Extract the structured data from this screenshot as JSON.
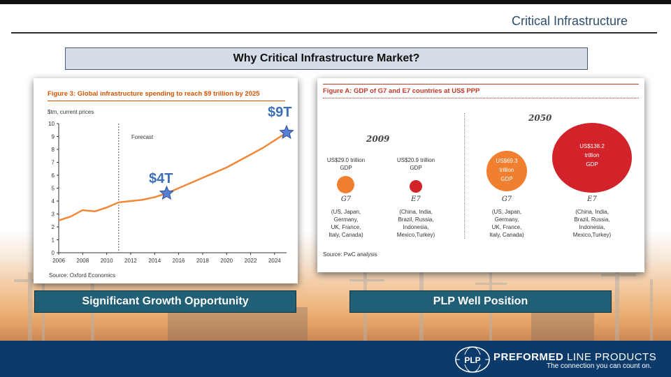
{
  "slide": {
    "title": "Critical Infrastructure",
    "banner": "Why Critical Infrastructure Market?",
    "left_caption": "Significant Growth Opportunity",
    "right_caption": "PLP Well Position"
  },
  "infra_chart": {
    "title": "Figure 3: Global infrastructure spending to reach $9 trillion by 2025",
    "unit": "$tm, current prices",
    "forecast_label": "Forecast",
    "source": "Source: Oxford Economics",
    "annotation_low": "$4T",
    "annotation_high": "$9T",
    "y_ticks": [
      "0",
      "1",
      "2",
      "3",
      "4",
      "5",
      "6",
      "7",
      "8",
      "9",
      "10"
    ],
    "x_ticks": [
      "2006",
      "2008",
      "2010",
      "2012",
      "2014",
      "2016",
      "2018",
      "2020",
      "2022",
      "2024"
    ]
  },
  "chart_data": {
    "type": "line",
    "title": "Figure 3: Global infrastructure spending to reach $9 trillion by 2025",
    "ylabel": "$tm, current prices",
    "xlabel": "",
    "ylim": [
      0,
      10
    ],
    "xlim": [
      2006,
      2025
    ],
    "forecast_start": 2011,
    "x": [
      2006,
      2007,
      2008,
      2009,
      2010,
      2011,
      2012,
      2013,
      2014,
      2015,
      2016,
      2017,
      2018,
      2019,
      2020,
      2021,
      2022,
      2023,
      2024,
      2025
    ],
    "series": [
      {
        "values": [
          2.5,
          2.8,
          3.3,
          3.2,
          3.5,
          3.9,
          4.0,
          4.1,
          4.3,
          4.6,
          5.0,
          5.4,
          5.8,
          6.2,
          6.6,
          7.1,
          7.6,
          8.1,
          8.7,
          9.3
        ]
      }
    ],
    "markers": [
      {
        "x": 2015,
        "y": 4.6,
        "label": "$4T"
      },
      {
        "x": 2025,
        "y": 9.3,
        "label": "$9T"
      }
    ],
    "grid": false,
    "colors": {
      "line": "#f0883a",
      "axis": "#333333"
    }
  },
  "gdp_figure": {
    "title": "Figure A: GDP of G7 and E7 countries at US$ PPP",
    "year_2009": "2009",
    "year_2050": "2050",
    "g7_2009_value": "US$29.0 trillion",
    "gdp_word": "GDP",
    "e7_2009_value": "US$20.9 trillion",
    "g7_2050_value_1": "US$69.3",
    "g7_2050_value_2": "trillion",
    "e7_2050_value_1": "US$138.2",
    "e7_2050_value_2": "trillion",
    "g7_label": "G7",
    "e7_label": "E7",
    "g7_members": [
      "(US, Japan,",
      "Germany,",
      "UK, France,",
      "Italy, Canada)"
    ],
    "e7_members": [
      "(China, India,",
      "Brazil, Russia,",
      "Indonesia,",
      "Mexico,Turkey)"
    ],
    "source": "Source: PwC analysis",
    "colors": {
      "g7": "#f08030",
      "e7": "#d2232a"
    }
  },
  "footer": {
    "logo_text": "PLP",
    "brand_bold": "PREFORMED",
    "brand_rest": " LINE PRODUCTS",
    "tagline": "The connection you can count on."
  }
}
